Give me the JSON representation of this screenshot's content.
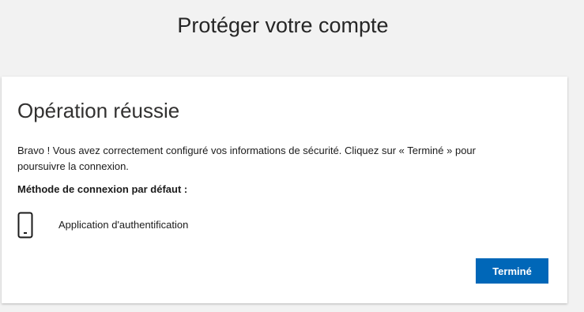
{
  "header": {
    "title": "Protéger votre compte"
  },
  "card": {
    "title": "Opération réussie",
    "message": "Bravo ! Vous avez correctement configuré vos informations de sécurité. Cliquez sur « Terminé » pour poursuivre la connexion.",
    "default_method_heading": "Méthode de connexion par défaut :",
    "default_method": {
      "icon": "smartphone-icon",
      "label": "Application d'authentification"
    },
    "done_label": "Terminé"
  },
  "colors": {
    "background": "#f2f2f2",
    "card": "#ffffff",
    "primary_button": "#0067b8"
  }
}
